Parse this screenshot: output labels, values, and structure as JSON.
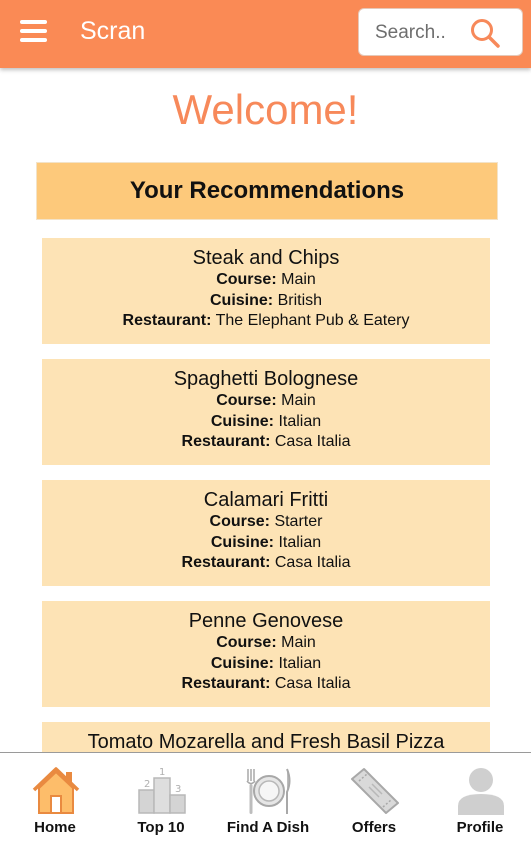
{
  "app_bar": {
    "title": "Scran",
    "search_placeholder": "Search..",
    "menu_icon": "hamburger-menu-icon",
    "search_icon": "search-icon"
  },
  "welcome": "Welcome!",
  "recommendations": {
    "heading": "Your Recommendations",
    "course_label": "Course:",
    "cuisine_label": "Cuisine:",
    "restaurant_label": "Restaurant:",
    "items": [
      {
        "dish": "Steak and Chips",
        "course": "Main",
        "cuisine": "British",
        "restaurant": "The Elephant Pub & Eatery"
      },
      {
        "dish": "Spaghetti Bolognese",
        "course": "Main",
        "cuisine": "Italian",
        "restaurant": "Casa Italia"
      },
      {
        "dish": "Calamari Fritti",
        "course": "Starter",
        "cuisine": "Italian",
        "restaurant": "Casa Italia"
      },
      {
        "dish": "Penne Genovese",
        "course": "Main",
        "cuisine": "Italian",
        "restaurant": "Casa Italia"
      },
      {
        "dish": "Tomato Mozarella and Fresh Basil Pizza"
      }
    ]
  },
  "bottom_nav": [
    {
      "label": "Home",
      "icon": "home-icon"
    },
    {
      "label": "Top 10",
      "icon": "podium-icon"
    },
    {
      "label": "Find A Dish",
      "icon": "plate-cutlery-icon"
    },
    {
      "label": "Offers",
      "icon": "coupon-icon"
    },
    {
      "label": "Profile",
      "icon": "profile-icon"
    }
  ],
  "colors": {
    "primary": "#fa8a55",
    "header_card": "#fdc97b",
    "item_card": "#fde3b5",
    "welcome_text": "#f7895a"
  }
}
